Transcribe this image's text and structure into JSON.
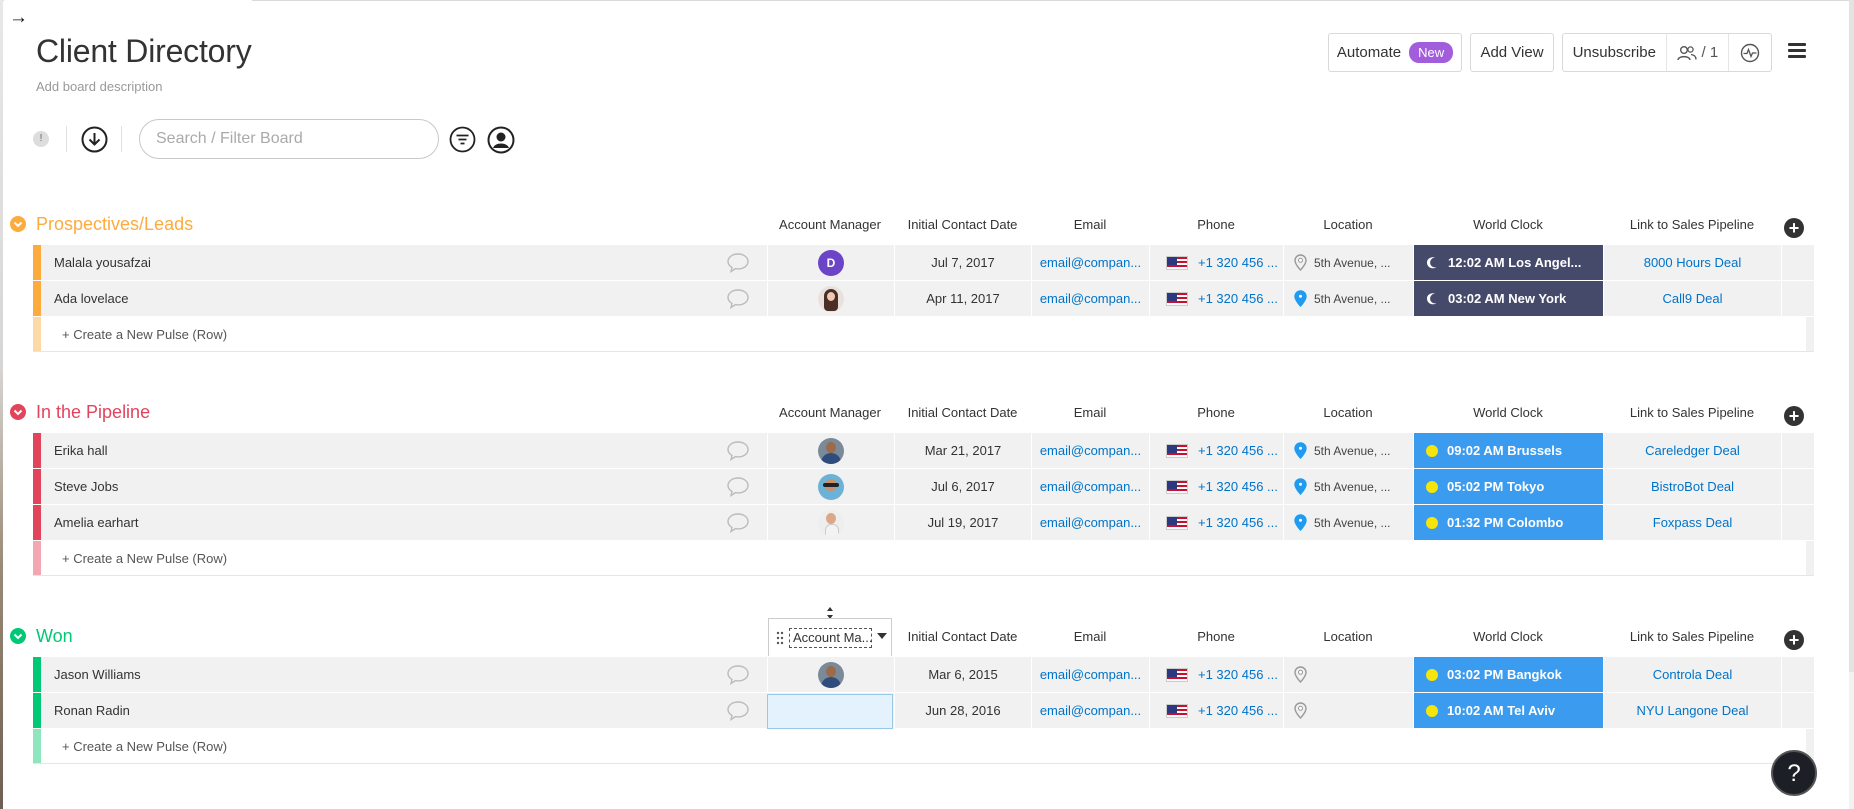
{
  "nav": {
    "back_arrow": "→"
  },
  "board": {
    "title": "Client Directory",
    "description": "Add board description"
  },
  "toolbar": {
    "automate_label": "Automate",
    "automate_badge": "New",
    "add_view_label": "Add View",
    "unsubscribe_label": "Unsubscribe",
    "subscribers_count": "/ 1",
    "info_badge": "!",
    "search_placeholder": "Search / Filter Board"
  },
  "columns": {
    "account_manager": "Account Manager",
    "initial_contact_date": "Initial Contact Date",
    "email": "Email",
    "phone": "Phone",
    "location": "Location",
    "world_clock": "World Clock",
    "link_to_sales_pipeline": "Link to Sales Pipeline",
    "account_manager_dragging": "Account Ma..."
  },
  "add_pulse_label": "+ Create a New Pulse (Row)",
  "groups": [
    {
      "title": "Prospectives/Leads",
      "color": "#fdab3d",
      "light_color": "#fed9a8",
      "rows": [
        {
          "name": "Malala yousafzai",
          "avatar_initial": "D",
          "date": "Jul 7, 2017",
          "email": "email@compan...",
          "phone": "+1 320 456 ...",
          "location": "5th Avenue, ...",
          "clock": "12:02 AM Los Angel...",
          "link": "8000 Hours Deal"
        },
        {
          "name": "Ada lovelace",
          "date": "Apr 11, 2017",
          "email": "email@compan...",
          "phone": "+1 320 456 ...",
          "location": "5th Avenue, ...",
          "clock": "03:02 AM New York",
          "link": "Call9 Deal"
        }
      ]
    },
    {
      "title": "In the Pipeline",
      "color": "#e2445c",
      "light_color": "#f4a7b3",
      "rows": [
        {
          "name": "Erika hall",
          "date": "Mar 21, 2017",
          "email": "email@compan...",
          "phone": "+1 320 456 ...",
          "location": "5th Avenue, ...",
          "clock": "09:02 AM Brussels",
          "link": "Careledger Deal"
        },
        {
          "name": "Steve Jobs",
          "date": "Jul 6, 2017",
          "email": "email@compan...",
          "phone": "+1 320 456 ...",
          "location": "5th Avenue, ...",
          "clock": "05:02 PM Tokyo",
          "link": "BistroBot Deal"
        },
        {
          "name": "Amelia earhart",
          "date": "Jul 19, 2017",
          "email": "email@compan...",
          "phone": "+1 320 456 ...",
          "location": "5th Avenue, ...",
          "clock": "01:32 PM Colombo",
          "link": "Foxpass Deal"
        }
      ]
    },
    {
      "title": "Won",
      "color": "#00c875",
      "light_color": "#8de6be",
      "rows": [
        {
          "name": "Jason Williams",
          "date": "Mar 6, 2015",
          "email": "email@compan...",
          "phone": "+1 320 456 ...",
          "location": "",
          "clock": "03:02 PM Bangkok",
          "link": "Controla Deal"
        },
        {
          "name": "Ronan Radin",
          "date": "Jun 28, 2016",
          "email": "email@compan...",
          "phone": "+1 320 456 ...",
          "location": "",
          "clock": "10:02 AM Tel Aviv",
          "link": "NYU Langone Deal"
        }
      ]
    }
  ],
  "help": {
    "label": "?"
  },
  "colors": {
    "link_blue": "#0073c9",
    "clock_night": "#454a6b",
    "clock_day": "#3b9bee",
    "automate_badge": "#a25ddc"
  }
}
